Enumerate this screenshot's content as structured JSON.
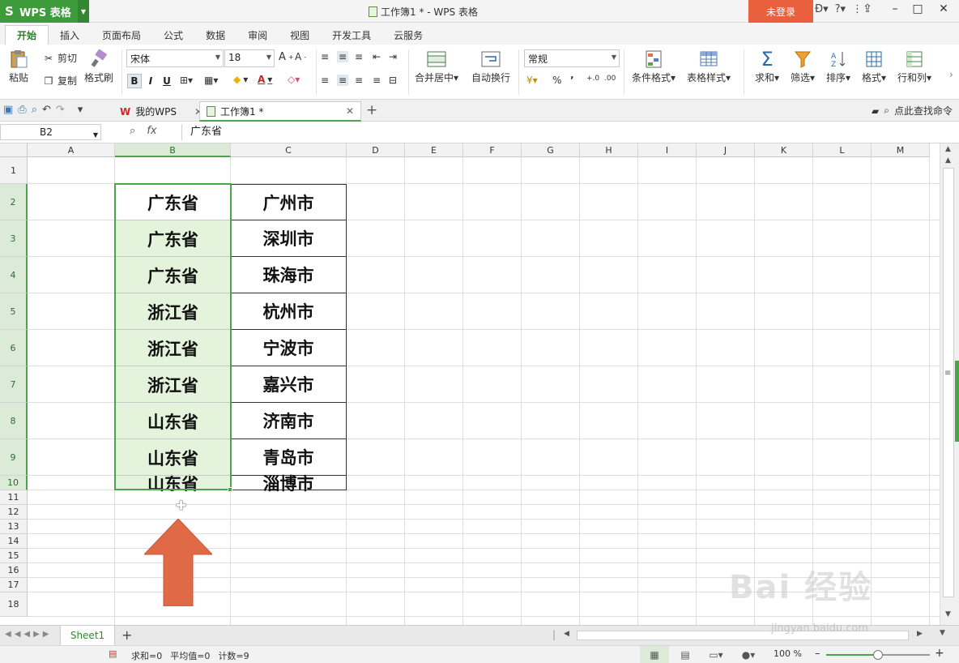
{
  "app": {
    "name": "WPS 表格",
    "window_title": "工作簿1 * - WPS 表格",
    "login": "未登录"
  },
  "ribbon_tabs": [
    "开始",
    "插入",
    "页面布局",
    "公式",
    "数据",
    "审阅",
    "视图",
    "开发工具",
    "云服务"
  ],
  "toolbar": {
    "paste": "粘贴",
    "cut": "剪切",
    "copy": "复制",
    "format_painter": "格式刷",
    "font_name": "宋体",
    "font_size": "18",
    "bold": "B",
    "italic": "I",
    "underline": "U",
    "merge_center": "合并居中",
    "wrap_text": "自动换行",
    "number_format": "常规",
    "percent": "%",
    "comma": "’",
    "cond_format": "条件格式",
    "table_style": "表格样式",
    "sum": "求和",
    "filter": "筛选",
    "sort": "排序",
    "format": "格式",
    "row_col": "行和列"
  },
  "doc_tabs": {
    "my_wps": "我的WPS",
    "workbook": "工作簿1 *"
  },
  "find_command": "点此查找命令",
  "formula_bar": {
    "name_box": "B2",
    "fx": "fx",
    "content": "广东省"
  },
  "columns": [
    "A",
    "B",
    "C",
    "D",
    "E",
    "F",
    "G",
    "H",
    "I",
    "J",
    "K",
    "L",
    "M"
  ],
  "rows": [
    "1",
    "2",
    "3",
    "4",
    "5",
    "6",
    "7",
    "8",
    "9",
    "10",
    "11",
    "12",
    "13",
    "14",
    "15",
    "16",
    "17",
    "18"
  ],
  "table": {
    "col_b": [
      "广东省",
      "广东省",
      "广东省",
      "浙江省",
      "浙江省",
      "浙江省",
      "山东省",
      "山东省",
      "山东省"
    ],
    "col_c": [
      "广州市",
      "深圳市",
      "珠海市",
      "杭州市",
      "宁波市",
      "嘉兴市",
      "济南市",
      "青岛市",
      "淄博市"
    ]
  },
  "sheet_tab": "Sheet1",
  "status": {
    "sum": "求和=0",
    "average": "平均值=0",
    "count": "计数=9",
    "zoom": "100 %",
    "zoom_value": 1.0
  },
  "watermark": {
    "main": "Bai 经验",
    "sub": "jingyan.baidu.com"
  },
  "colors": {
    "accent_green": "#4ba34b",
    "selection_fill": "#e3f3dc",
    "login_red": "#e9603f",
    "arrow_orange": "#df6a45"
  }
}
